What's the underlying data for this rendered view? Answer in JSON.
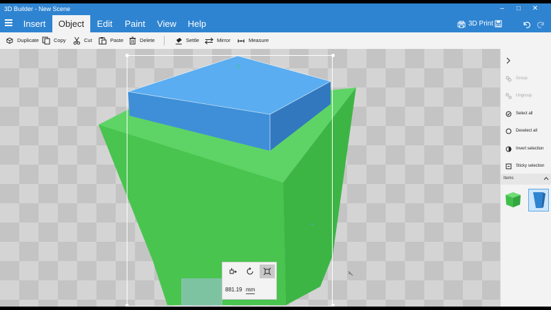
{
  "window": {
    "title": "3D Builder - New Scene",
    "minimize": "–",
    "maximize": "□",
    "close": "✕"
  },
  "menu": {
    "tabs": [
      {
        "label": "Insert"
      },
      {
        "label": "Object"
      },
      {
        "label": "Edit"
      },
      {
        "label": "Paint"
      },
      {
        "label": "View"
      },
      {
        "label": "Help"
      }
    ],
    "active_tab": "Object",
    "print_label": "3D Print"
  },
  "toolbar": {
    "duplicate": "Duplicate",
    "copy": "Copy",
    "cut": "Cut",
    "paste": "Paste",
    "delete": "Delete",
    "settle": "Settle",
    "mirror": "Mirror",
    "measure": "Measure"
  },
  "sidepanel": {
    "commands": [
      {
        "label": "Group",
        "enabled": false
      },
      {
        "label": "Ungroup",
        "enabled": false
      },
      {
        "label": "Select all",
        "enabled": true
      },
      {
        "label": "Deselect all",
        "enabled": true
      },
      {
        "label": "Invert selection",
        "enabled": true
      },
      {
        "label": "Sticky selection",
        "enabled": true
      }
    ],
    "items_label": "Items",
    "items": [
      {
        "icon": "green-box-icon",
        "color": "#3fbf4a",
        "selected": false
      },
      {
        "icon": "blue-box-icon",
        "color": "#2f84d1",
        "selected": true
      }
    ]
  },
  "scale_widget": {
    "value": "881.19",
    "unit": "mm",
    "active_tool": "scale"
  },
  "colors": {
    "accent": "#2f84d1",
    "green_object": "#49c44f",
    "blue_object": "#4a9ee8"
  }
}
